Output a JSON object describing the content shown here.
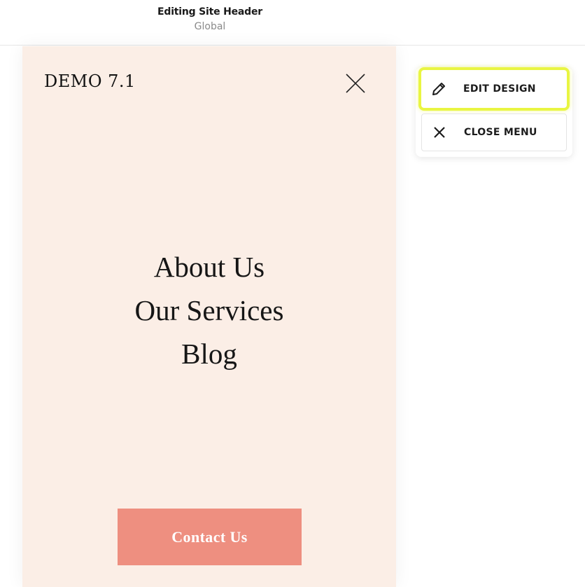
{
  "header": {
    "title": "Editing Site Header",
    "subtitle": "Global"
  },
  "site": {
    "title": "DEMO 7.1",
    "nav_items": [
      "About Us",
      "Our Services",
      "Blog"
    ],
    "cta_label": "Contact Us",
    "background_color": "#fbeee6",
    "cta_color": "#ee8f80"
  },
  "actions": {
    "edit_design_label": "EDIT DESIGN",
    "close_menu_label": "CLOSE MENU",
    "highlight_color": "#e9f542"
  }
}
